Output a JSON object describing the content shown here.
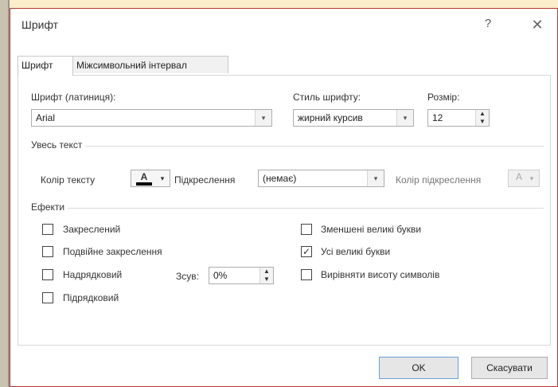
{
  "dialog": {
    "title": "Шрифт",
    "help": "?",
    "close": "✕"
  },
  "tabs": [
    {
      "label": "Шрифт"
    },
    {
      "label": "Міжсимвольний інтервал"
    }
  ],
  "font": {
    "label": "Шрифт (латиниця):",
    "value": "Arial",
    "style_label": "Стиль шрифту:",
    "style_value": "жирний курсив",
    "size_label": "Розмір:",
    "size_value": "12"
  },
  "all_text": {
    "group_label": "Увесь текст",
    "color_label": "Колір тексту",
    "underline_label": "Підкреслення",
    "underline_value": "(немає)",
    "underline_color_label": "Колір підкреслення"
  },
  "effects": {
    "group_label": "Ефекти",
    "strikethrough": {
      "label": "Закреслений",
      "checked": false
    },
    "double_strikethrough": {
      "label": "Подвійне закреслення",
      "checked": false
    },
    "superscript": {
      "label": "Надрядковий",
      "checked": false
    },
    "subscript": {
      "label": "Підрядковий",
      "checked": false
    },
    "offset_label": "Зсув:",
    "offset_value": "0%",
    "small_caps": {
      "label": "Зменшені великі букви",
      "checked": false
    },
    "all_caps": {
      "label": "Усі великі букви",
      "checked": true,
      "mark": "✓"
    },
    "equalize_height": {
      "label": "Вирівняти висоту символів",
      "checked": false
    }
  },
  "buttons": {
    "ok": "OK",
    "cancel": "Скасувати"
  },
  "icons": {
    "dropdown": "▾",
    "spin_up": "▲",
    "spin_down": "▼",
    "text_color_icon": "А"
  },
  "colors": {
    "accent_border": "#b33a2e",
    "background": "#fbeecb",
    "text_color_swatch": "#000000"
  }
}
